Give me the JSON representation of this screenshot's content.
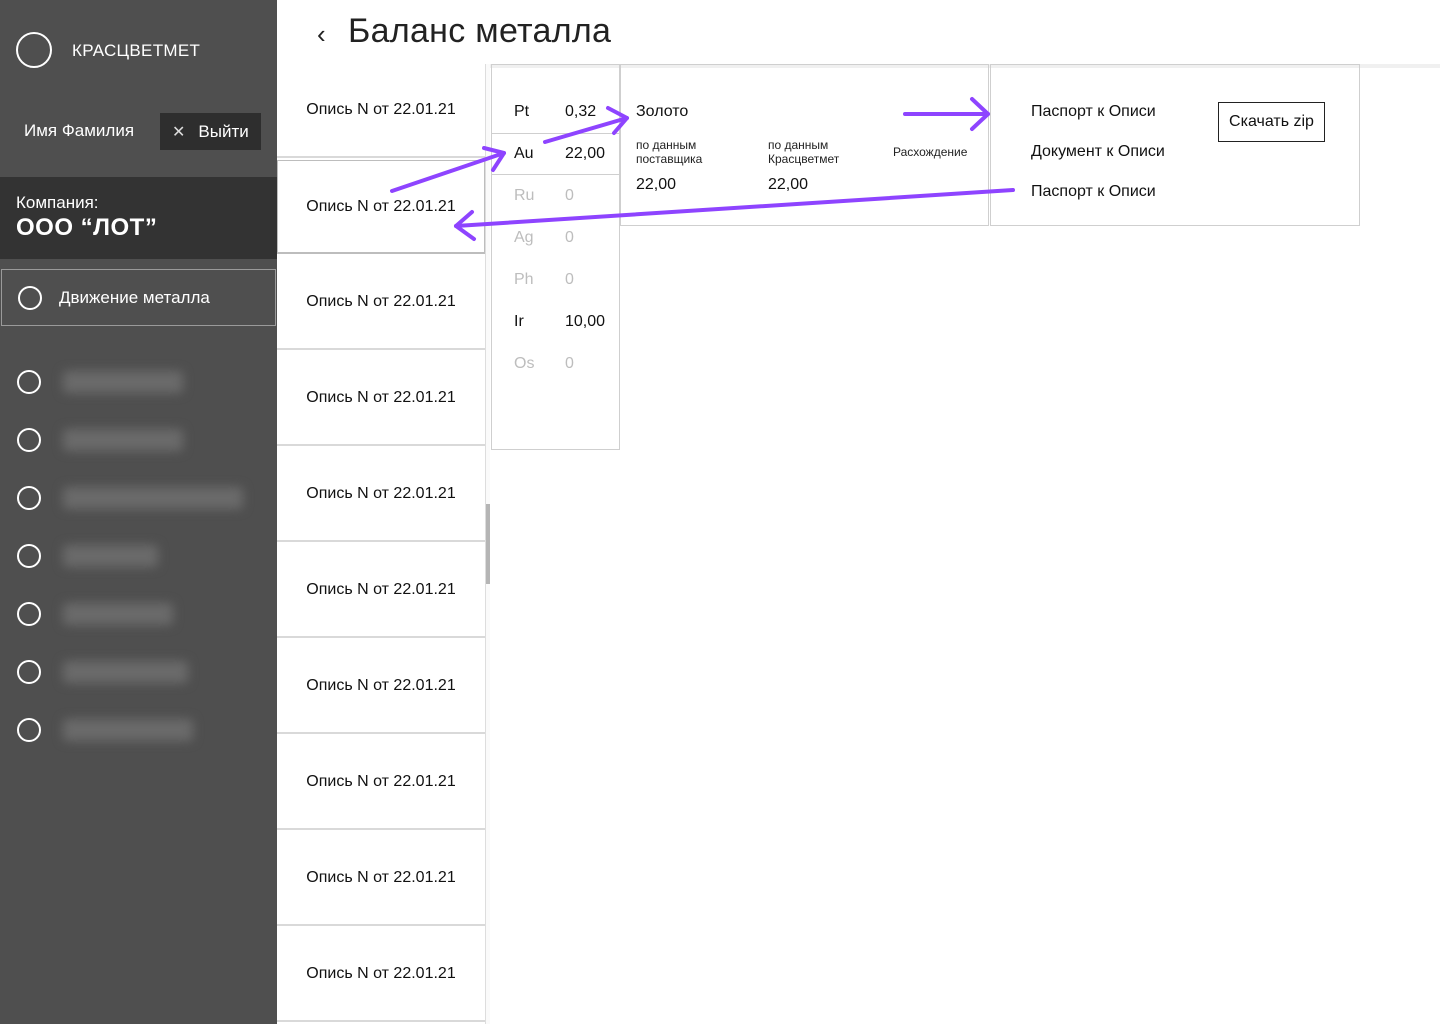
{
  "sidebar": {
    "brand": "КРАСЦВЕТМЕТ",
    "user_name": "Имя Фамилия",
    "logout_label": "Выйти",
    "company_label": "Компания:",
    "company_name": "ООО “ЛОТ”",
    "active_item": "Движение металла",
    "blurred_items_count": 7
  },
  "header": {
    "back_icon": "chevron-left-icon",
    "title": "Баланс металла"
  },
  "inventory_list": [
    "Опись N от 22.01.21",
    "Опись N от 22.01.21",
    "Опись N от 22.01.21",
    "Опись N от 22.01.21",
    "Опись N от 22.01.21",
    "Опись N от 22.01.21",
    "Опись N от 22.01.21",
    "Опись N от 22.01.21",
    "Опись N от 22.01.21",
    "Опись N от 22.01.21"
  ],
  "metals": [
    {
      "symbol": "Pt",
      "value": "0,32",
      "dim": false
    },
    {
      "symbol": "Au",
      "value": "22,00",
      "dim": false
    },
    {
      "symbol": "Ru",
      "value": "0",
      "dim": true
    },
    {
      "symbol": "Ag",
      "value": "0",
      "dim": true
    },
    {
      "symbol": "Ph",
      "value": "0",
      "dim": true
    },
    {
      "symbol": "Ir",
      "value": "10,00",
      "dim": false
    },
    {
      "symbol": "Os",
      "value": "0",
      "dim": true
    }
  ],
  "detail": {
    "metal_name": "Золото",
    "supplier_caption_1": "по данным",
    "supplier_caption_2": "поставщика",
    "company_caption_1": "по данным",
    "company_caption_2": "Красцветмет",
    "diff_caption": "Расхождение",
    "supplier_value": "22,00",
    "company_value": "22,00"
  },
  "docs": {
    "items": [
      "Паспорт к Описи",
      "Документ к Описи",
      "Паспорт к Описи"
    ],
    "download_label": "Скачать zip"
  },
  "colors": {
    "sidebar_bg": "#4f4f4f",
    "company_bg": "#333333",
    "logout_bg": "#2e2e2e",
    "annotation": "#8e44ff"
  }
}
